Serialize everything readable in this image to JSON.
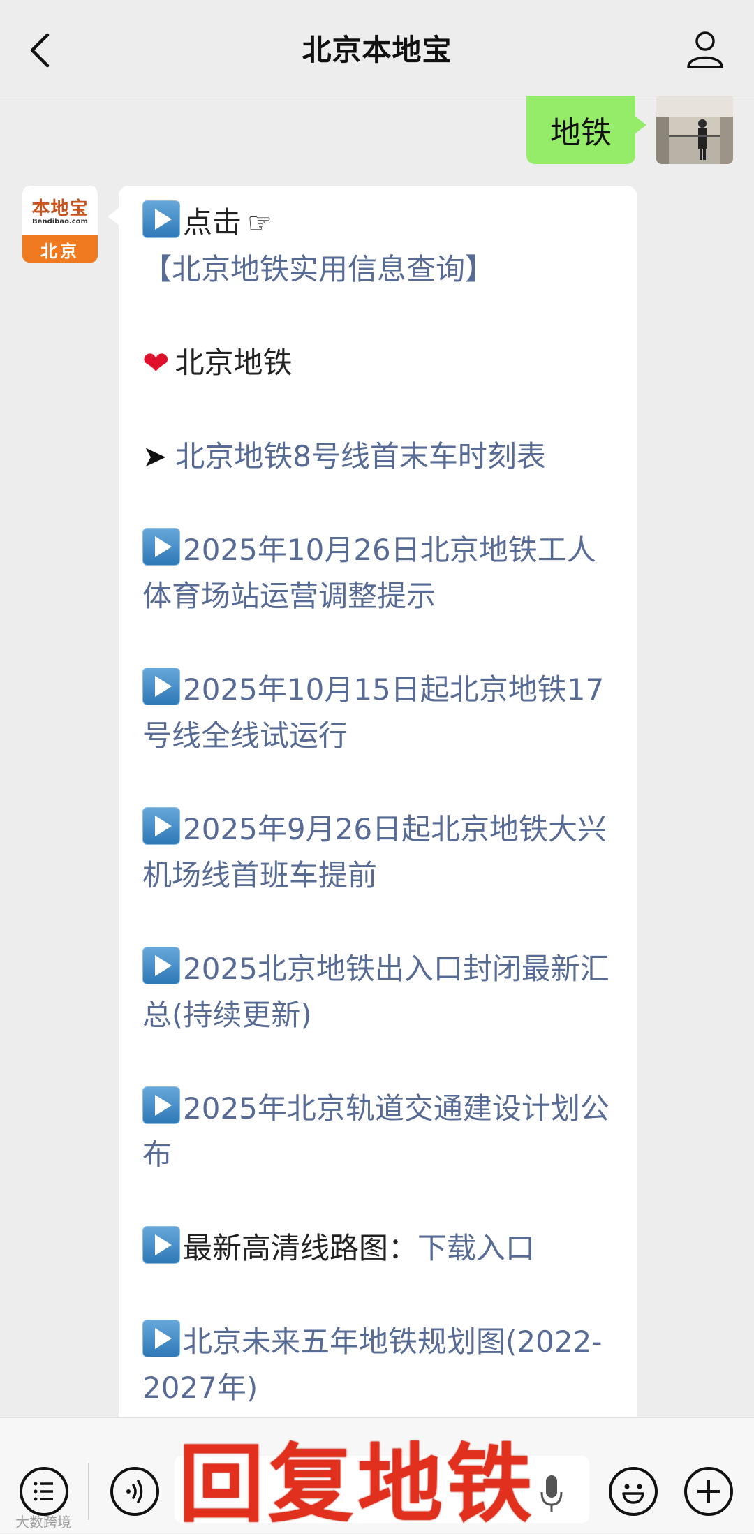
{
  "header": {
    "title": "北京本地宝"
  },
  "user_message": {
    "text": "地铁"
  },
  "bot_avatar": {
    "brand": "本地宝",
    "url": "Bendibao.com",
    "city": "北京"
  },
  "bot_message": {
    "click_prefix": "点击",
    "click_link": "【北京地铁实用信息查询】",
    "section_title": "北京地铁",
    "line8_link": "北京地铁8号线首末车时刻表",
    "items": [
      "2025年10月26日北京地铁工人体育场站运营调整提示",
      "2025年10月15日起北京地铁17号线全线试运行",
      "2025年9月26日起北京地铁大兴机场线首班车提前",
      "2025北京地铁出入口封闭最新汇总(持续更新)",
      "2025年北京轨道交通建设计划公布"
    ],
    "route_map_label": "最新高清线路图：",
    "route_map_link": "下载入口",
    "future_plan": "北京未来五年地铁规划图(2022-2027年)"
  },
  "input_bar": {
    "overlay_text": "回复地铁"
  },
  "watermark": "大数跨境",
  "colors": {
    "user_bubble": "#95ec69",
    "link": "#576b95",
    "overlay": "#e1301d"
  },
  "icons": [
    "back-icon",
    "profile-icon",
    "play-icon",
    "heart-icon",
    "arrow-icon",
    "hand-icon",
    "menu-icon",
    "voice-icon",
    "mic-icon",
    "emoji-icon",
    "plus-icon"
  ]
}
